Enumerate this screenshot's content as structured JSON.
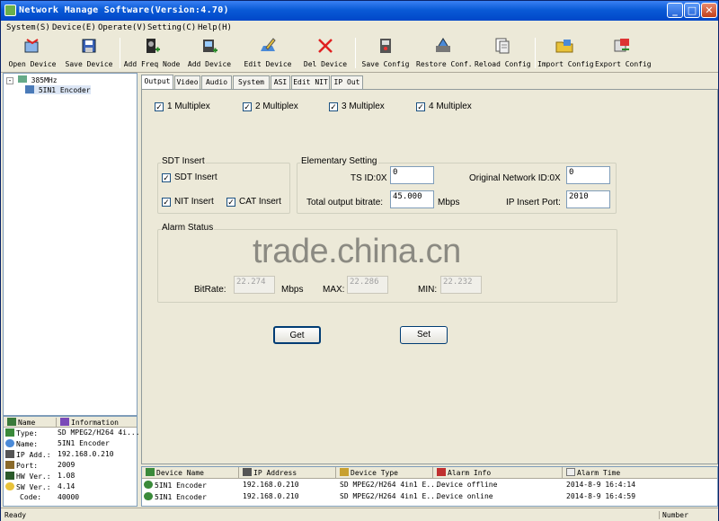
{
  "window": {
    "title": "Network Manage Software(Version:4.70)"
  },
  "menu": [
    "System(S)",
    "Device(E)",
    "Operate(V)",
    "Setting(C)",
    "Help(H)"
  ],
  "toolbar": [
    {
      "label": "Open Device",
      "icon": "open-device-icon"
    },
    {
      "label": "Save Device",
      "icon": "save-device-icon"
    },
    {
      "label": "Add Freq Node",
      "icon": "add-freq-node-icon"
    },
    {
      "label": "Add Device",
      "icon": "add-device-icon"
    },
    {
      "label": "Edit Device",
      "icon": "edit-device-icon"
    },
    {
      "label": "Del Device",
      "icon": "delete-icon"
    },
    {
      "label": "Save Config",
      "icon": "save-config-icon"
    },
    {
      "label": "Restore Conf.",
      "icon": "restore-config-icon"
    },
    {
      "label": "Reload Config",
      "icon": "reload-config-icon"
    },
    {
      "label": "Import Config",
      "icon": "import-config-icon"
    },
    {
      "label": "Export Config",
      "icon": "export-config-icon"
    }
  ],
  "tree": {
    "root": "385MHz",
    "child": "5IN1  Encoder"
  },
  "info": {
    "header_name": "Name",
    "header_info": "Information",
    "rows": [
      {
        "k": "Type:",
        "v": "SD MPEG2/H264 4i..."
      },
      {
        "k": "Name:",
        "v": "5IN1  Encoder"
      },
      {
        "k": "IP Add.:",
        "v": "192.168.0.210"
      },
      {
        "k": "Port:",
        "v": "2009"
      },
      {
        "k": "HW Ver.:",
        "v": "1.08"
      },
      {
        "k": "SW Ver.:",
        "v": "4.14"
      },
      {
        "k": "Code:",
        "v": "40000"
      }
    ]
  },
  "tabs": [
    "Output",
    "Video",
    "Audio",
    "System",
    "ASI",
    "Edit NIT",
    "IP Out"
  ],
  "multiplex": [
    "1 Multiplex",
    "2 Multiplex",
    "3 Multiplex",
    "4 Multiplex"
  ],
  "sdt_group": {
    "title": "SDT Insert",
    "sdt": "SDT Insert",
    "nit": "NIT Insert",
    "cat": "CAT Insert"
  },
  "elementary": {
    "title": "Elementary Setting",
    "ts_id_label": "TS ID:0X",
    "ts_id": "0",
    "onid_label": "Original Network ID:0X",
    "onid": "0",
    "bitrate_label": "Total output bitrate:",
    "bitrate": "45.000",
    "bitrate_unit": "Mbps",
    "ip_port_label": "IP Insert Port:",
    "ip_port": "2010"
  },
  "alarm": {
    "title": "Alarm Status",
    "bitrate_label": "BitRate:",
    "bitrate": "22.274",
    "unit": "Mbps",
    "max_label": "MAX:",
    "max": "22.286",
    "min_label": "MIN:",
    "min": "22.232"
  },
  "watermark": "trade.china.cn",
  "buttons": {
    "get": "Get",
    "set": "Set"
  },
  "log": {
    "headers": [
      "Device Name",
      "IP Address",
      "Device Type",
      "Alarm Info",
      "Alarm Time"
    ],
    "rows": [
      [
        "5IN1  Encoder",
        "192.168.0.210",
        "SD MPEG2/H264 4in1 E...",
        "Device offline",
        "2014-8-9 16:4:14"
      ],
      [
        "5IN1  Encoder",
        "192.168.0.210",
        "SD MPEG2/H264 4in1 E...",
        "Device online",
        "2014-8-9 16:4:59"
      ]
    ]
  },
  "status": {
    "left": "Ready",
    "right": "Number"
  }
}
